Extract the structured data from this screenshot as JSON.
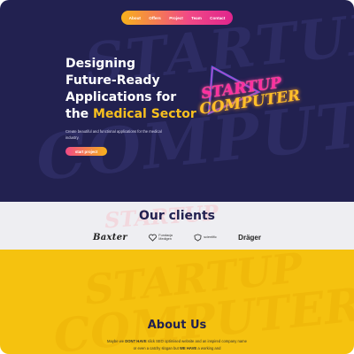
{
  "nav": {
    "items": [
      "About",
      "Offers",
      "Project",
      "Team",
      "Contact"
    ]
  },
  "hero": {
    "watermark_1": "STARTUP",
    "watermark_2": "COMPUTER",
    "title_line1": "Designing",
    "title_line2": "Future-Ready",
    "title_line3": "Applications for",
    "title_line4_prefix": "the ",
    "title_line4_highlight": "Medical Sector",
    "description": "Create beautiful  and functional applications for the medical industry.",
    "cta_label": "start project",
    "neon_line1": "STARTUP",
    "neon_line2": "COMPUTER",
    "colors": {
      "accent_pink": "#f14a86",
      "accent_yellow": "#f7c01f",
      "background": "#222150"
    }
  },
  "clients": {
    "watermark": "STARTUP",
    "title": "Our clients",
    "logos": [
      {
        "name": "Baxter",
        "text": "Baxter"
      },
      {
        "name": "Fundacja Medycyny",
        "line1": "Fundacja",
        "line2": "Medigen"
      },
      {
        "name": "Scientific",
        "text": "scientific"
      },
      {
        "name": "Dräger",
        "text": "Dräger"
      }
    ]
  },
  "about": {
    "watermark_1": "STARTUP",
    "watermark_2": "COMPUTER",
    "title": "About Us",
    "text_1": "Maybe we ",
    "text_bold_1": "DONT HAVE",
    "text_2": " slick SEO optimised website and an inspired company name or even a catchy slogan but ",
    "text_bold_2": "WE HAVE",
    "text_3": " a working and",
    "colors": {
      "background": "#f5c20f"
    }
  }
}
